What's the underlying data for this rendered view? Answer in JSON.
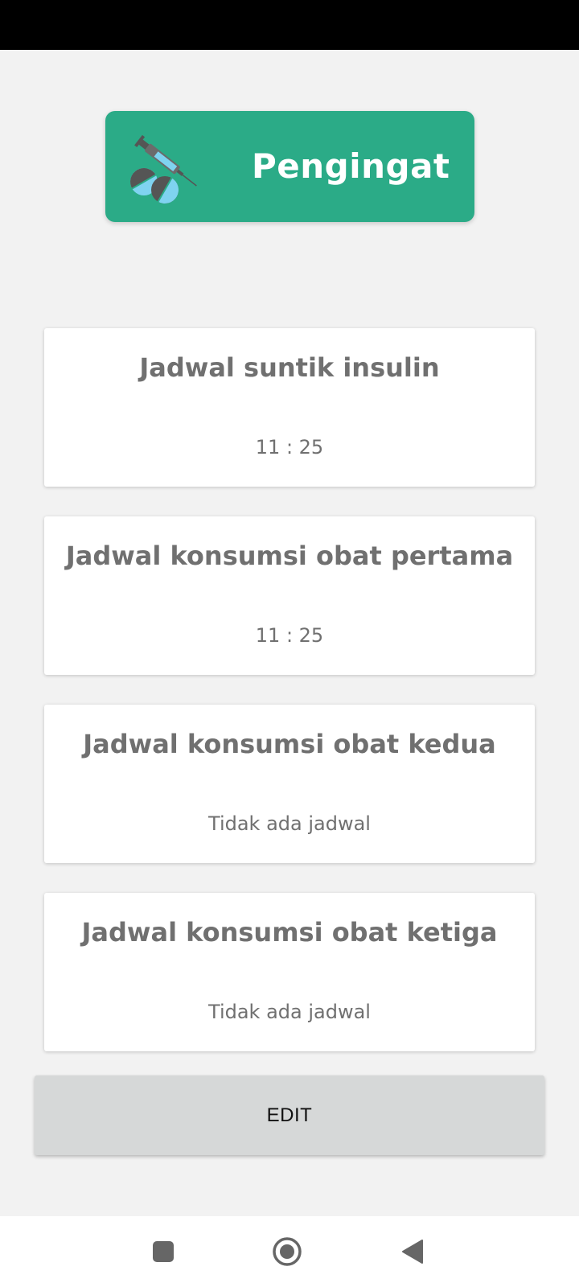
{
  "header": {
    "title": "Pengingat",
    "icon": "syringe-pills-icon",
    "color": "#2bab87"
  },
  "schedules": [
    {
      "title": "Jadwal suntik insulin",
      "value": "11 : 25"
    },
    {
      "title": "Jadwal konsumsi obat pertama",
      "value": "11 : 25"
    },
    {
      "title": "Jadwal konsumsi obat kedua",
      "value": "Tidak ada jadwal"
    },
    {
      "title": "Jadwal konsumsi obat ketiga",
      "value": "Tidak ada jadwal"
    }
  ],
  "edit_button": {
    "label": "EDIT"
  },
  "nav_bar": {
    "icons": [
      "recents-square-icon",
      "home-circle-icon",
      "back-triangle-icon"
    ]
  }
}
